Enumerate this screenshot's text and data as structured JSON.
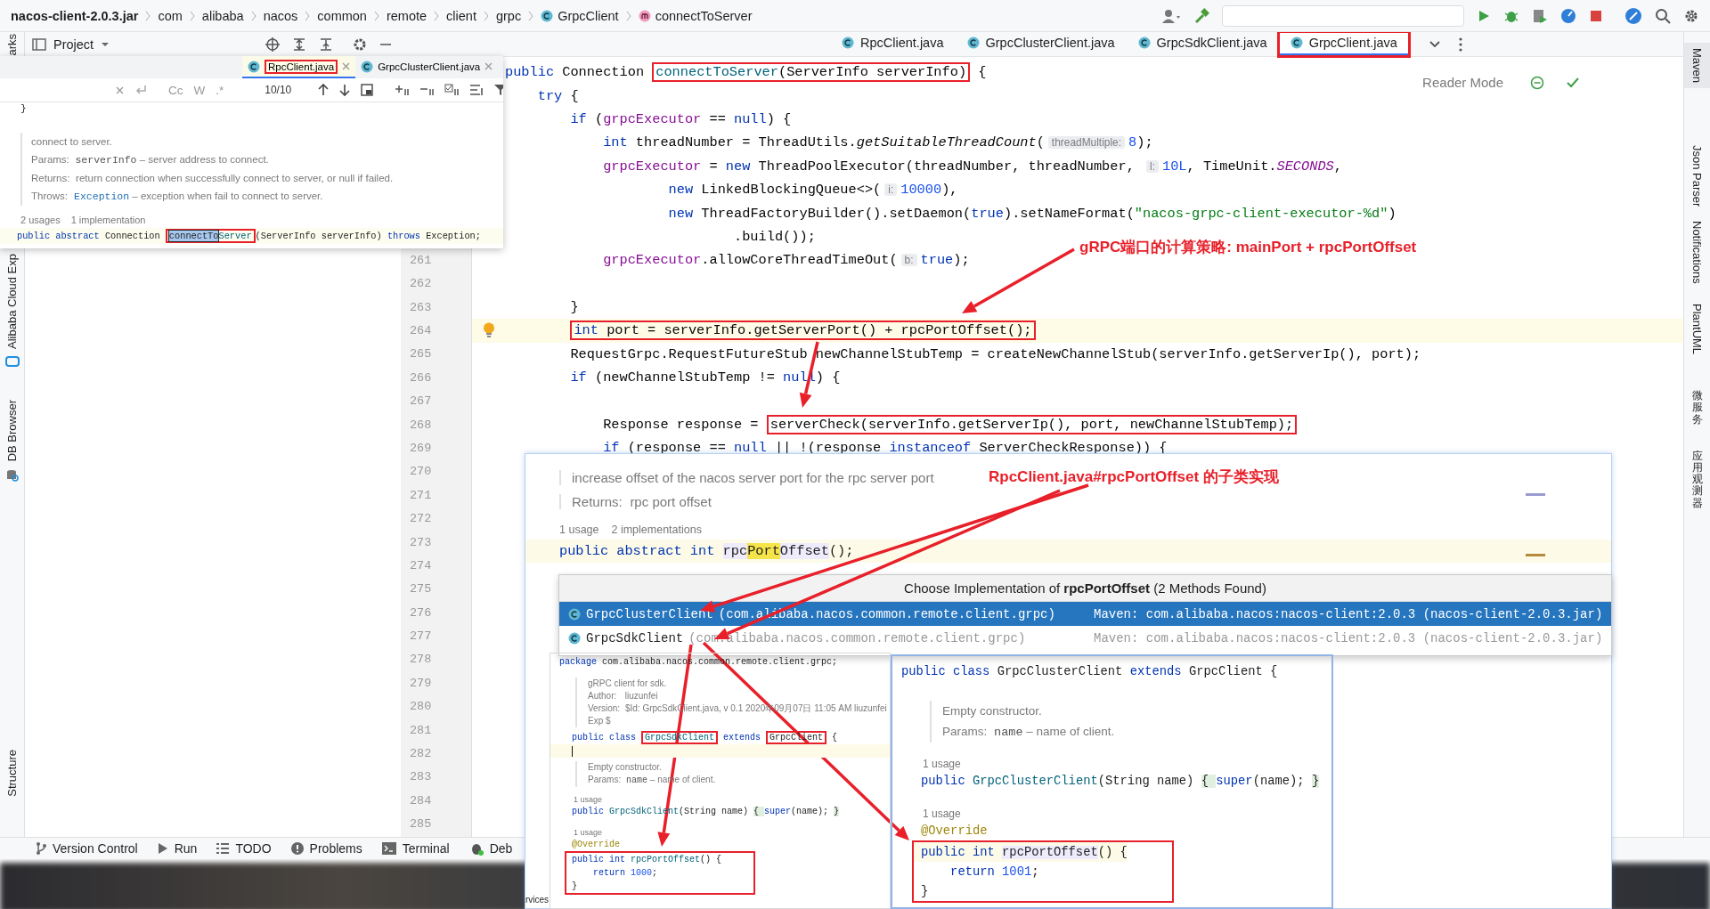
{
  "breadcrumbs": [
    {
      "text": "nacos-client-2.0.3.jar",
      "kind": "jar"
    },
    {
      "text": "com",
      "kind": "package"
    },
    {
      "text": "alibaba",
      "kind": "package"
    },
    {
      "text": "nacos",
      "kind": "package"
    },
    {
      "text": "common",
      "kind": "package"
    },
    {
      "text": "remote",
      "kind": "package"
    },
    {
      "text": "client",
      "kind": "package"
    },
    {
      "text": "grpc",
      "kind": "package"
    },
    {
      "text": "GrpcClient",
      "kind": "class"
    },
    {
      "text": "connectToServer",
      "kind": "method"
    }
  ],
  "left_strip": [
    "arks",
    "Alibaba Cloud Exp",
    "DB Browser",
    "Structure"
  ],
  "project_title": "Project",
  "editor_tabs": [
    {
      "label": "RpcClient.java",
      "selected": false,
      "framed": false
    },
    {
      "label": "GrpcClusterClient.java",
      "selected": false,
      "framed": false
    },
    {
      "label": "GrpcSdkClient.java",
      "selected": false,
      "framed": false
    },
    {
      "label": "GrpcClient.java",
      "selected": true,
      "framed": true
    }
  ],
  "reader_mode": "Reader Mode",
  "editor_lines": [
    {
      "current": false,
      "segments": [
        {
          "kind": "keyword",
          "text": "public "
        },
        "Connection ",
        {
          "kind": "frame",
          "parts": [
            {
              "kind": "declaration",
              "text": "connectToServer"
            },
            "(ServerInfo serverInfo)"
          ]
        },
        " {"
      ],
      "children": [
        {
          "current": false,
          "segments": [
            {
              "kind": "keyword",
              "text": "try"
            },
            " {"
          ],
          "children": [
            {
              "current": false,
              "segments": [
                {
                  "kind": "keyword",
                  "text": "if"
                },
                " (",
                {
                  "kind": "field",
                  "text": "grpcExecutor"
                },
                " == ",
                {
                  "kind": "keyword",
                  "text": "null"
                },
                ") {"
              ],
              "children": [
                {
                  "current": false,
                  "segments": [
                    {
                      "kind": "keyword",
                      "text": "int"
                    },
                    " threadNumber = ThreadUtils.",
                    {
                      "kind": "static",
                      "text": "getSuitableThreadCount"
                    },
                    "(",
                    {
                      "kind": "hint",
                      "text": "threadMultiple:"
                    },
                    {
                      "kind": "number",
                      "text": "8"
                    },
                    ");"
                  ]
                },
                {
                  "current": false,
                  "segments": [
                    {
                      "kind": "field",
                      "text": "grpcExecutor"
                    },
                    " = ",
                    {
                      "kind": "keyword",
                      "text": "new"
                    },
                    " ThreadPoolExecutor(threadNumber, threadNumber, ",
                    {
                      "kind": "hint",
                      "text": "l:"
                    },
                    {
                      "kind": "number",
                      "text": "10L"
                    },
                    ", TimeUnit.",
                    {
                      "kind": "static_field",
                      "text": "SECONDS"
                    },
                    ","
                  ],
                  "children": [
                    {
                      "kind": "continuation",
                      "current": false,
                      "segments": [
                        {
                          "kind": "keyword",
                          "text": "new"
                        },
                        " LinkedBlockingQueue<>(",
                        {
                          "kind": "hint",
                          "text": "i:"
                        },
                        {
                          "kind": "number",
                          "text": "10000"
                        },
                        "),"
                      ]
                    },
                    {
                      "kind": "continuation",
                      "current": false,
                      "segments": [
                        {
                          "kind": "keyword",
                          "text": "new"
                        },
                        " ThreadFactoryBuilder().setDaemon(",
                        {
                          "kind": "keyword",
                          "text": "true"
                        },
                        ").setNameFormat(",
                        {
                          "kind": "string",
                          "text": "\"nacos-grpc-client-executor-%d\""
                        },
                        ")"
                      ],
                      "children": [
                        {
                          "kind": "continuation",
                          "current": false,
                          "segments": [
                            ".build());"
                          ]
                        }
                      ]
                    }
                  ]
                },
                {
                  "number": "261",
                  "current": false,
                  "segments": [
                    {
                      "kind": "field",
                      "text": "grpcExecutor"
                    },
                    ".allowCoreThreadTimeOut(",
                    {
                      "kind": "hint",
                      "text": "b:"
                    },
                    {
                      "kind": "keyword",
                      "text": "true"
                    },
                    ");"
                  ]
                },
                {
                  "number": "262",
                  "current": false
                }
              ]
            },
            {
              "number": "263",
              "current": false,
              "segments": [
                "}"
              ]
            },
            {
              "number": "264",
              "current": true,
              "segments": [
                {
                  "kind": "frame",
                  "parts": [
                    {
                      "kind": "keyword",
                      "text": "int"
                    },
                    " port = serverInfo.getServerPort() + rpcPortOffset();"
                  ]
                }
              ]
            },
            {
              "number": "265",
              "current": false,
              "segments": [
                "RequestGrpc.RequestFutureStub newChannelStubTemp = createNewChannelStub(serverInfo.getServerIp(), port);"
              ]
            },
            {
              "number": "266",
              "current": false,
              "segments": [
                {
                  "kind": "keyword",
                  "text": "if"
                },
                " (newChannelStubTemp != ",
                {
                  "kind": "keyword",
                  "text": "null"
                },
                ") {"
              ],
              "children": [
                {
                  "number": "267",
                  "current": false
                },
                {
                  "number": "268",
                  "current": false,
                  "segments": [
                    "Response response = ",
                    {
                      "kind": "frame",
                      "parts": [
                        "serverCheck(serverInfo.getServerIp(), port, newChannelStubTemp);"
                      ]
                    }
                  ]
                },
                {
                  "number": "269",
                  "current": false,
                  "segments": [
                    {
                      "kind": "keyword",
                      "text": "if"
                    },
                    " (response == ",
                    {
                      "kind": "keyword",
                      "text": "null"
                    },
                    " || !(response ",
                    {
                      "kind": "keyword",
                      "text": "instanceof"
                    },
                    " ServerCheckResponse)) {"
                  ]
                }
              ]
            }
          ]
        }
      ]
    },
    {
      "number": "270",
      "current": false
    },
    {
      "number": "271",
      "current": false
    },
    {
      "number": "272",
      "current": false
    },
    {
      "number": "273",
      "current": false
    },
    {
      "number": "274",
      "current": false
    },
    {
      "number": "275",
      "current": false
    },
    {
      "number": "276",
      "current": false
    },
    {
      "number": "277",
      "current": false
    },
    {
      "number": "278",
      "current": false
    },
    {
      "number": "279",
      "current": false
    },
    {
      "number": "280",
      "current": false
    },
    {
      "number": "281",
      "current": false
    },
    {
      "number": "282",
      "current": false
    },
    {
      "number": "283",
      "current": false
    },
    {
      "number": "284",
      "current": false
    },
    {
      "number": "285",
      "current": false
    }
  ],
  "right_strip": [
    {
      "text": "Maven",
      "kind": "latin"
    },
    {
      "text": "Json Parser",
      "kind": "latin"
    },
    {
      "text": "Notifications",
      "kind": "latin"
    },
    {
      "text": "PlantUML",
      "kind": "latin"
    },
    {
      "text": "微服务",
      "kind": "cjk"
    },
    {
      "text": "应用观测器",
      "kind": "cjk"
    }
  ],
  "bottom_tabs": [
    "Version Control",
    "Run",
    "TODO",
    "Problems",
    "Terminal",
    "Deb"
  ],
  "usage_popup": {
    "tabs": [
      {
        "label": "RpcClient.java",
        "selected": true,
        "framed": true
      },
      {
        "label": "GrpcClusterClient.java",
        "selected": false,
        "framed": false
      }
    ],
    "toolbar": {
      "case_toggle": "Cc",
      "word_toggle": "W",
      "regex_toggle": ".*",
      "match_count": "10/10"
    },
    "code_before": "}",
    "doc": [
      {
        "text": "connect to server."
      },
      {
        "label": "Params:",
        "segments": [
          {
            "kind": "code",
            "text": "serverInfo"
          },
          " – server address to connect."
        ]
      },
      {
        "label": "Returns:",
        "segments": [
          "return connection when successfully connect to server, or null if failed."
        ]
      },
      {
        "label": "Throws:",
        "segments": [
          {
            "kind": "link",
            "text": "Exception"
          },
          " – exception when fail to connect to server."
        ]
      }
    ],
    "usages": "2 usages",
    "implementations": "1 implementation",
    "declaration": [
      {
        "kind": "keyword",
        "text": "public abstract "
      },
      "Connection ",
      {
        "kind": "frame",
        "parts": [
          {
            "kind": "selection",
            "text": "connectTo"
          },
          {
            "kind": "declaration",
            "text": "Server"
          }
        ]
      },
      "(ServerInfo serverInfo) ",
      {
        "kind": "keyword",
        "text": "throws"
      },
      " Exception;"
    ]
  },
  "doc_popup": {
    "doc": [
      {
        "text": "increase offset of the nacos server port for the rpc server port"
      },
      {
        "label": "Returns:",
        "segments": [
          "rpc port offset"
        ]
      }
    ],
    "usages": "1 usage",
    "implementations": "2 implementations",
    "declaration": [
      {
        "kind": "keyword",
        "text": "public abstract int "
      },
      {
        "kind": "usage",
        "text": "rpc"
      },
      {
        "kind": "match",
        "text": "Port"
      },
      {
        "kind": "usage",
        "text": "Offset"
      },
      "();"
    ],
    "services_tab": "rvices"
  },
  "implementation_chooser": {
    "title": "Choose Implementation of **rpcPortOffset** (2 Methods Found)",
    "rows": [
      {
        "name": "GrpcClusterClient",
        "package": "(com.alibaba.nacos.common.remote.client.grpc)",
        "location": "Maven: com.alibaba.nacos:nacos-client:2.0.3 (nacos-client-2.0.3.jar)",
        "selected": true
      },
      {
        "name": "GrpcSdkClient",
        "package": "(com.alibaba.nacos.common.remote.client.grpc)",
        "location": "Maven: com.alibaba.nacos:nacos-client:2.0.3 (nacos-client-2.0.3.jar)",
        "selected": false
      }
    ]
  },
  "sdk_client_preview": [
    {
      "kind": "code",
      "segments": [
        {
          "kind": "keyword",
          "text": "package"
        },
        " com.alibaba.nacos.common.remote.client.grpc;"
      ]
    },
    {
      "kind": "blank"
    },
    {
      "kind": "doc",
      "text": "gRPC client for sdk."
    },
    {
      "kind": "doc",
      "label": "Author:",
      "segments": [
        "liuzunfei"
      ]
    },
    {
      "kind": "doc",
      "label": "Version:",
      "segments": [
        "$Id: GrpcSdkClient.java, v 0.1 2020年09月07日 11:05 AM liuzunfei Exp $"
      ]
    },
    {
      "kind": "code",
      "segments": [
        {
          "kind": "keyword",
          "text": "public class "
        },
        {
          "kind": "frame",
          "parts": [
            {
              "kind": "declaration",
              "text": "GrpcSdkClient"
            }
          ]
        },
        {
          "kind": "keyword",
          "text": " extends "
        },
        {
          "kind": "frame",
          "parts": [
            "GrpcClient"
          ]
        },
        " {"
      ]
    },
    {
      "kind": "caret"
    },
    {
      "kind": "doc",
      "text": "Empty constructor."
    },
    {
      "kind": "doc",
      "label": "Params:",
      "segments": [
        {
          "kind": "code",
          "text": "name"
        },
        " – name of client."
      ]
    },
    {
      "kind": "usage",
      "text": "1 usage"
    },
    {
      "kind": "code",
      "segments": [
        {
          "kind": "keyword",
          "text": "public "
        },
        {
          "kind": "declaration",
          "text": "GrpcSdkClient"
        },
        "(String name) ",
        {
          "kind": "fold",
          "text": "{ "
        },
        {
          "kind": "keyword",
          "text": "super"
        },
        "(name); ",
        {
          "kind": "fold",
          "text": "}"
        }
      ]
    },
    {
      "kind": "blank"
    },
    {
      "kind": "usage",
      "text": "1 usage"
    },
    {
      "kind": "code",
      "segments": [
        {
          "kind": "annotation",
          "text": "@Override"
        }
      ]
    },
    {
      "kind": "frame",
      "lines": [
        {
          "segments": [
            {
              "kind": "keyword",
              "text": "public int "
            },
            {
              "kind": "declaration",
              "text": "rpcPortOffset"
            },
            "() {"
          ],
          "children": [
            {
              "segments": [
                {
                  "kind": "keyword",
                  "text": "return "
                },
                {
                  "kind": "number",
                  "text": "1000"
                },
                ";"
              ]
            }
          ]
        },
        {
          "segments": [
            "}"
          ]
        }
      ]
    }
  ],
  "cluster_client_preview": [
    {
      "kind": "code",
      "segments": [
        {
          "kind": "keyword",
          "text": "public class "
        },
        "GrpcClusterClient ",
        {
          "kind": "keyword",
          "text": "extends"
        },
        " GrpcClient {"
      ]
    },
    {
      "kind": "blank"
    },
    {
      "kind": "doc",
      "text": "Empty constructor."
    },
    {
      "kind": "doc",
      "label": "Params:",
      "segments": [
        {
          "kind": "code",
          "text": "name"
        },
        " – name of client."
      ]
    },
    {
      "kind": "usage",
      "text": "1 usage"
    },
    {
      "kind": "code",
      "segments": [
        {
          "kind": "keyword",
          "text": "public "
        },
        {
          "kind": "declaration",
          "text": "GrpcClusterClient"
        },
        "(String name) ",
        {
          "kind": "fold",
          "text": "{ "
        },
        {
          "kind": "keyword",
          "text": "super"
        },
        "(name); ",
        {
          "kind": "fold",
          "text": "}"
        }
      ]
    },
    {
      "kind": "blank"
    },
    {
      "kind": "usage",
      "text": "1 usage"
    },
    {
      "kind": "code",
      "segments": [
        {
          "kind": "annotation",
          "text": "@Override"
        }
      ]
    },
    {
      "kind": "frame",
      "lines": [
        {
          "current": true,
          "segments": [
            {
              "kind": "keyword",
              "text": "public int "
            },
            {
              "kind": "usage",
              "text": "rpcPortOffset"
            },
            "() {"
          ],
          "children": [
            {
              "current": false,
              "segments": [
                {
                  "kind": "keyword",
                  "text": "return "
                },
                {
                  "kind": "number",
                  "text": "1001"
                },
                ";"
              ]
            }
          ]
        },
        {
          "current": false,
          "segments": [
            "}"
          ]
        }
      ]
    }
  ],
  "annotations": [
    {
      "text": "gRPC端口的计算策略: mainPort + rpcPortOffset"
    },
    {
      "text": "RpcClient.java#rpcPortOffset 的子类实现"
    }
  ]
}
